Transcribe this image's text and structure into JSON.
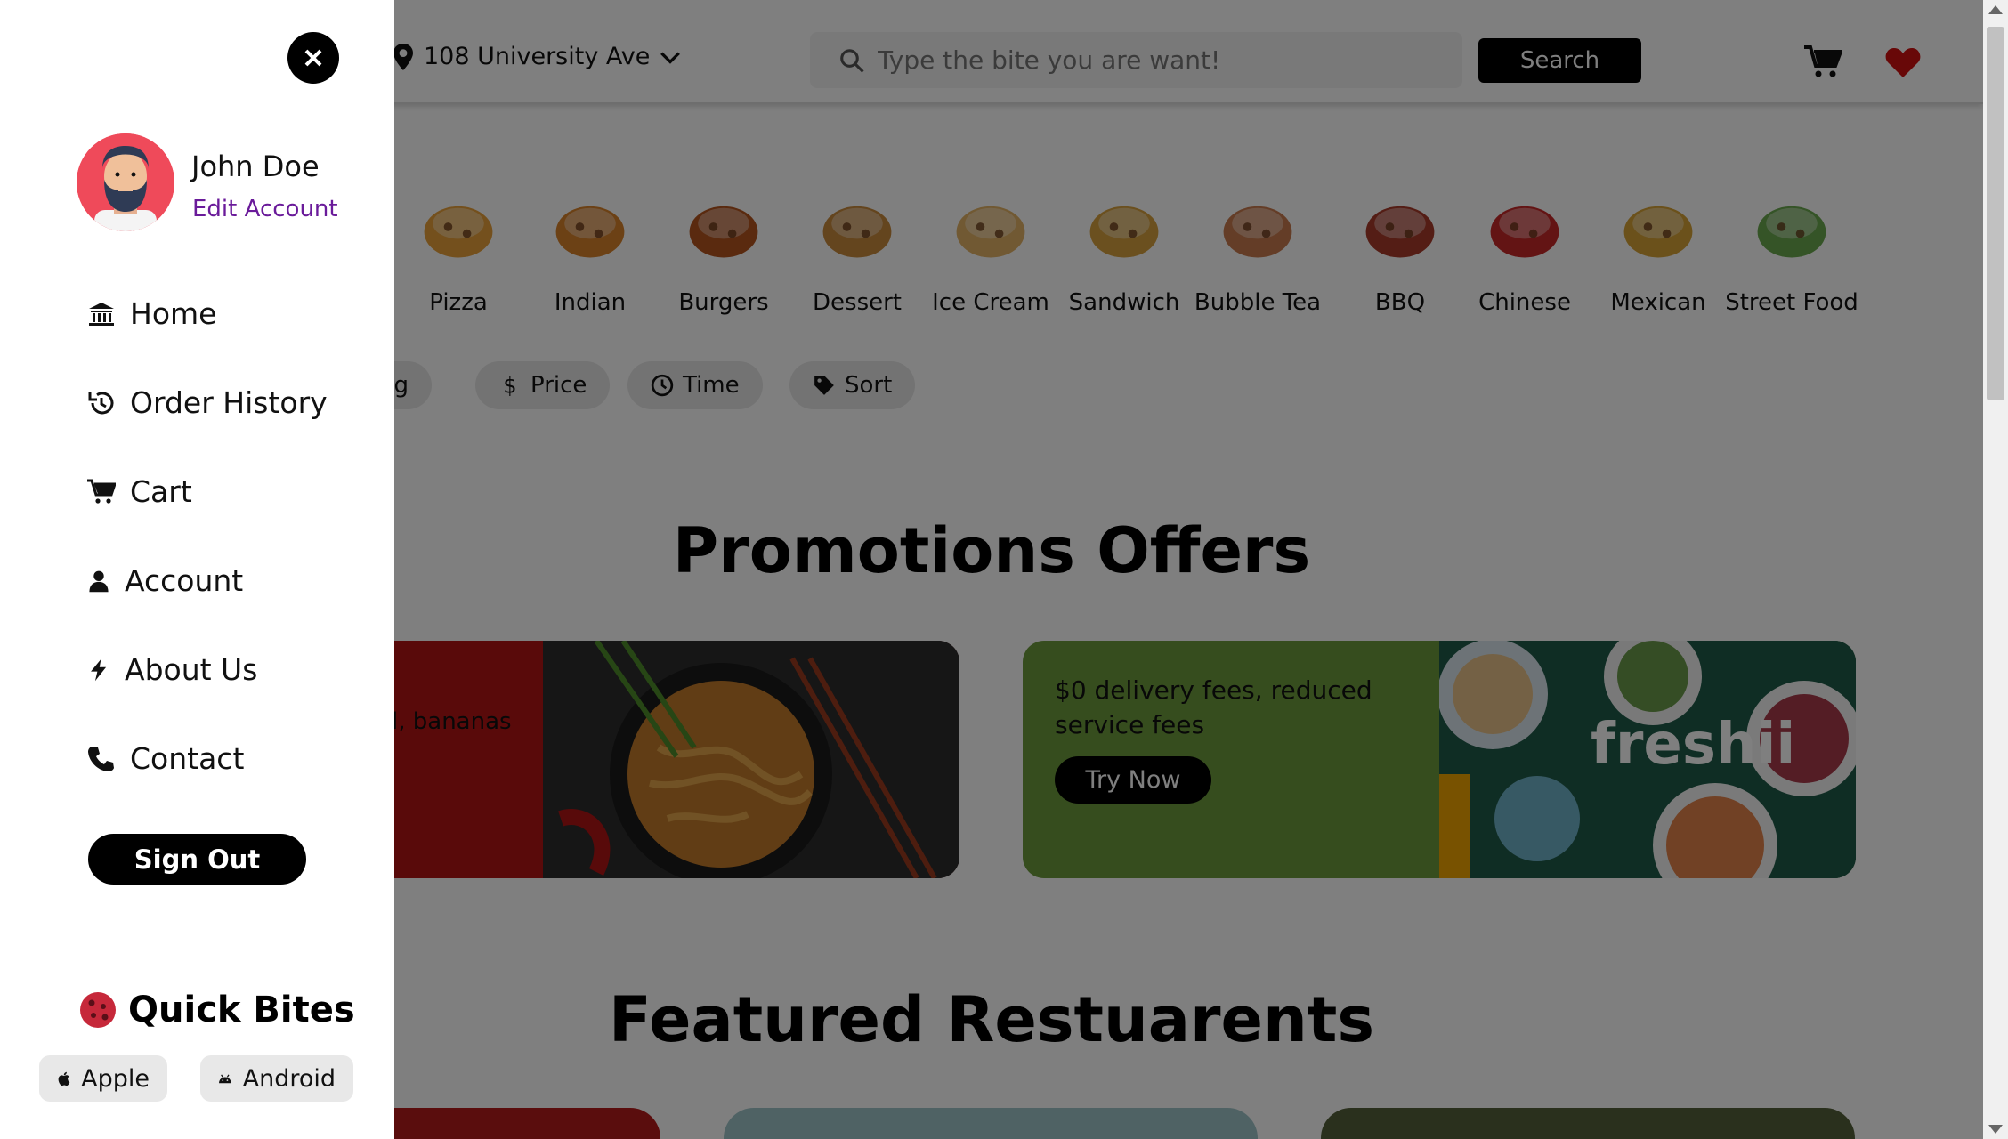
{
  "header": {
    "location": "108 University Ave",
    "search_placeholder": "Type the bite you are want!",
    "search_button": "Search"
  },
  "categories": [
    {
      "label": "Pizza",
      "icon": "pizza-icon",
      "color": "#e8a13a"
    },
    {
      "label": "Indian",
      "icon": "indian-icon",
      "color": "#d9822b"
    },
    {
      "label": "Burgers",
      "icon": "burger-icon",
      "color": "#b4541e"
    },
    {
      "label": "Dessert",
      "icon": "cookie-icon",
      "color": "#c98a3d"
    },
    {
      "label": "Ice Cream",
      "icon": "ice-cream-icon",
      "color": "#e2b366"
    },
    {
      "label": "Sandwich",
      "icon": "sandwich-icon",
      "color": "#d7a13f"
    },
    {
      "label": "Bubble Tea",
      "icon": "bubble-tea-icon",
      "color": "#c97b4e"
    },
    {
      "label": "BBQ",
      "icon": "bbq-icon",
      "color": "#a83b2a"
    },
    {
      "label": "Chinese",
      "icon": "takeout-box-icon",
      "color": "#c62828"
    },
    {
      "label": "Mexican",
      "icon": "taco-icon",
      "color": "#d6a236"
    },
    {
      "label": "Street Food",
      "icon": "skewer-icon",
      "color": "#6aa84f"
    }
  ],
  "filters": [
    {
      "label": "ng",
      "icon": "rating-icon"
    },
    {
      "label": "Price",
      "icon": "dollar-icon"
    },
    {
      "label": "Time",
      "icon": "clock-icon"
    },
    {
      "label": "Sort",
      "icon": "tag-icon"
    }
  ],
  "promotions": {
    "title": "Promotions Offers",
    "offer1_text": "l, bananas",
    "offer2_text": "$0 delivery fees, reduced service fees",
    "offer2_button": "Try Now",
    "offer2_brand": "freshii"
  },
  "featured": {
    "title": "Featured Restuarents"
  },
  "drawer": {
    "user_name": "John Doe",
    "edit_account": "Edit Account",
    "nav": [
      {
        "label": "Home",
        "icon": "bank-icon"
      },
      {
        "label": "Order History",
        "icon": "history-icon"
      },
      {
        "label": "Cart",
        "icon": "cart-icon"
      },
      {
        "label": "Account",
        "icon": "user-icon"
      },
      {
        "label": "About Us",
        "icon": "bolt-icon"
      },
      {
        "label": "Contact",
        "icon": "phone-icon"
      }
    ],
    "sign_out": "Sign Out",
    "brand": "Quick Bites",
    "apple": "Apple",
    "android": "Android"
  },
  "colors": {
    "accent_purple": "#6a1b9a",
    "heart_red": "#d01010",
    "promo1_bg": "#b31414",
    "promo2_bg": "#6d9a3d"
  }
}
